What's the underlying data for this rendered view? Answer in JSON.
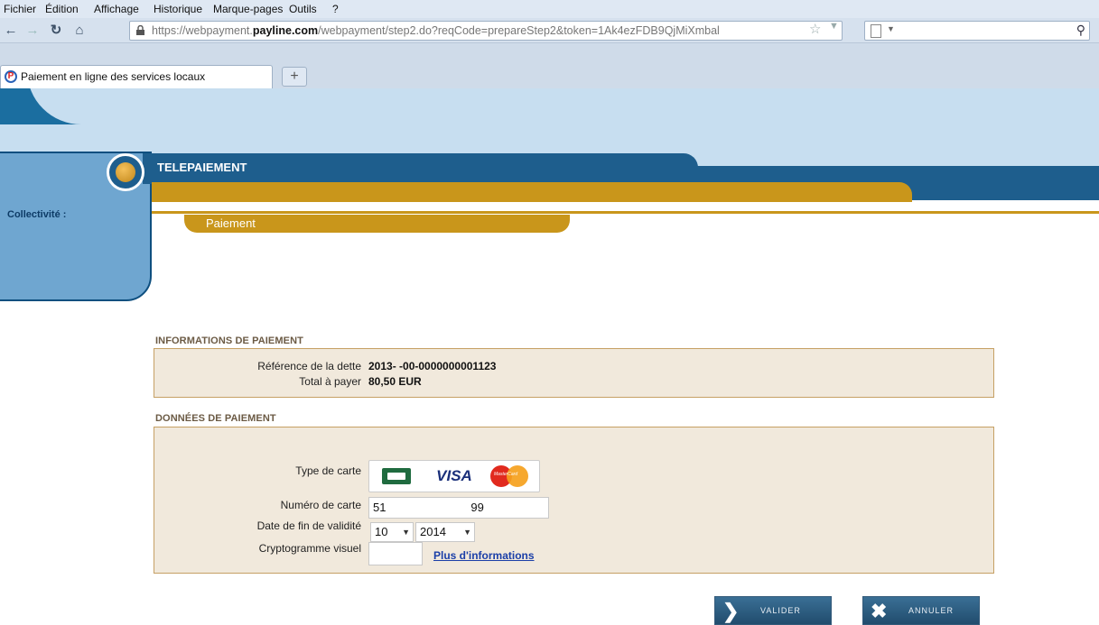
{
  "browser": {
    "menu": [
      "Fichier",
      "Édition",
      "Affichage",
      "Historique",
      "Marque-pages",
      "Outils",
      "?"
    ],
    "url_prefix": "https://webpayment.",
    "url_domain": "payline.com",
    "url_rest": "/webpayment/step2.do?reqCode=prepareStep2&token=1Ak4ezFDB9QjMiXmbal",
    "tab_title": "Paiement en ligne des services locaux",
    "new_tab": "+"
  },
  "header": {
    "title": "TELEPAIEMENT",
    "collectivite_label": "Collectivité :",
    "subtab": "Paiement"
  },
  "payment_info": {
    "section_title": "INFORMATIONS DE PAIEMENT",
    "reference_label": "Référence de la dette",
    "reference_value": "2013-    -00-0000000001123",
    "total_label": "Total à payer",
    "total_value": "80,50 EUR"
  },
  "payment_data": {
    "section_title": "DONNÉES DE PAIEMENT",
    "card_type_label": "Type de carte",
    "card_types": {
      "visa": "VISA",
      "mastercard": "MasterCard"
    },
    "card_number_label": "Numéro de carte",
    "card_number_value": "51                          99",
    "expiry_label": "Date de fin de validité",
    "expiry_month": "10",
    "expiry_year": "2014",
    "cvv_label": "Cryptogramme visuel",
    "cvv_value": "",
    "more_info_link": "Plus d'informations"
  },
  "actions": {
    "validate_label": "VALIDER",
    "cancel_label": "ANNULER"
  },
  "colors": {
    "brand_blue": "#1e5e8d",
    "gold": "#c9961b",
    "box_bg": "#f1e9dc"
  }
}
